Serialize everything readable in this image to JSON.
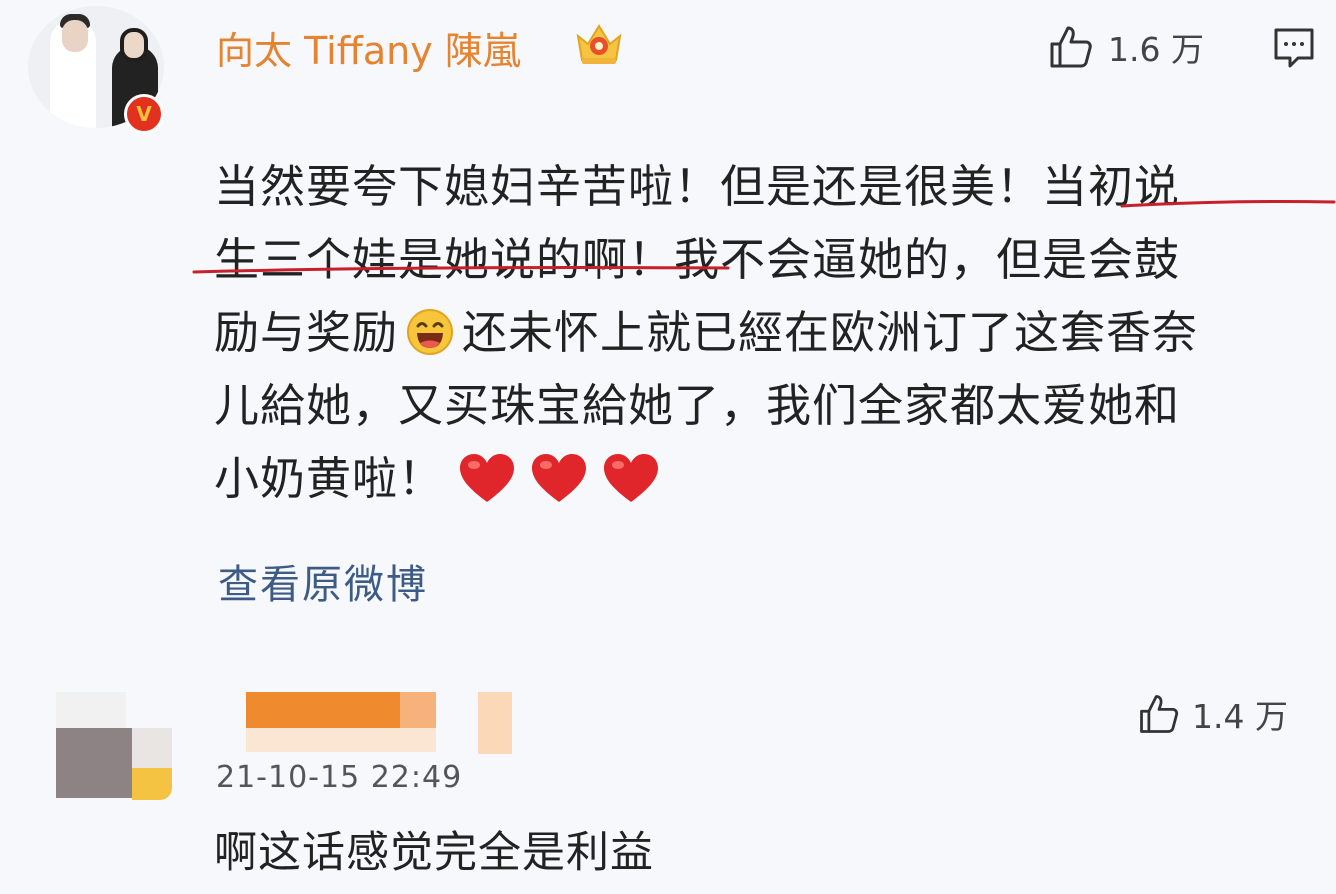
{
  "comment_1": {
    "username": "向太 Tiffany 陳嵐",
    "verified_badge": "V",
    "crown_icon": "crown-badge-icon",
    "like_icon": "thumbs-up-icon",
    "like_count": "1.6 万",
    "reply_icon": "comment-bubble-icon",
    "content": {
      "line1_a": "当然要夸下媳妇辛苦啦！但是还是很美！",
      "line1_b": "当初说",
      "line2_a": "生三个娃是她说的啊！",
      "line2_b": "我不会逼她的，但是会鼓",
      "line3_a": "励与奖励",
      "line3_emoji": "laughing-emoji",
      "line3_b": "还未怀上就已經在欧洲订了这套香奈",
      "line4": "儿給她，又买珠宝給她了，我们全家都太爱她和",
      "line5": "小奶黄啦！",
      "heart_emoji": "red-heart-emoji"
    },
    "view_original": "查看原微博"
  },
  "comment_2": {
    "like_icon": "thumbs-up-icon",
    "like_count": "1.4 万",
    "timestamp": "21-10-15 22:49",
    "content": "啊这话感觉完全是利益"
  },
  "colors": {
    "username": "#e58330",
    "link": "#3d5b84",
    "underline": "#c8202a",
    "verified": "#e2311f",
    "heart": "#e0262b"
  }
}
